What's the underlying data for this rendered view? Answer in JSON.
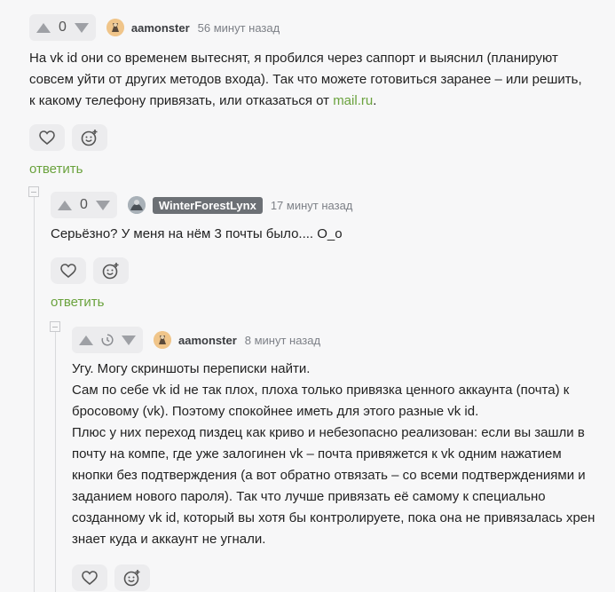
{
  "comments": [
    {
      "score": "0",
      "author": "aamonster",
      "time": "56 минут назад",
      "text_before_link": "На vk id они со временем вытеснят, я пробился через саппорт и выяснил (планируют совсем уйти от других методов входа). Так что можете готовиться заранее – или решить, к какому телефону привязать, или отказаться от ",
      "link_text": "mail.ru",
      "text_after_link": ".",
      "reply_label": "ответить"
    },
    {
      "score": "0",
      "author": "WinterForestLynx",
      "time": "17 минут назад",
      "text": "Серьёзно? У меня на нём 3 почты было.... О_о",
      "reply_label": "ответить"
    },
    {
      "author": "aamonster",
      "time": "8 минут назад",
      "paragraphs": [
        "Угу. Могу скриншоты переписки найти.",
        "Сам по себе vk id не так плох, плоха только привязка ценного аккаунта (почта) к бросовому (vk). Поэтому спокойнее иметь для этого разные vk id.",
        "Плюс у них переход пиздец как криво и небезопасно реализован: если вы зашли в почту на компе, где уже залогинен vk – почта привяжется к vk одним нажатием кнопки без подтверждения (а вот обратно отвязать – со всеми подтверждениями и заданием нового пароля). Так что лучше привязать её самому к специально созданному vk id, который вы хотя бы контролируете, пока она не привязалась хрен знает куда и аккаунт не угнали."
      ]
    }
  ],
  "icons": [
    "arrow-up-icon",
    "arrow-down-icon",
    "clock-icon",
    "heart-icon",
    "emoji-add-icon",
    "collapse-icon"
  ],
  "colors": {
    "accent": "#6aa23d",
    "background": "#f7f7f8",
    "control_bg": "#ececee",
    "badge_bg": "#6c7075"
  }
}
